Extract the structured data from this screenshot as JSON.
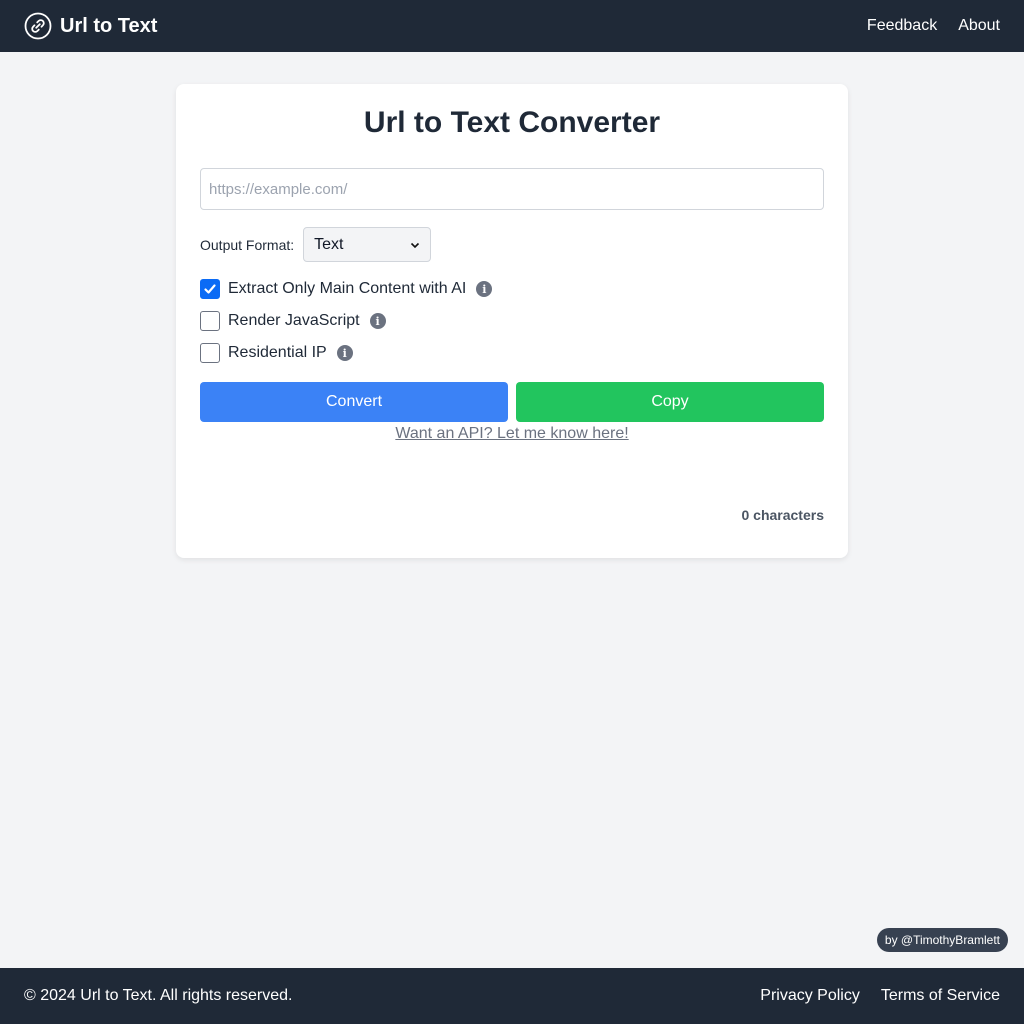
{
  "header": {
    "app_name": "Url to Text",
    "logo_icon": "link-icon",
    "nav": [
      {
        "label": "Feedback"
      },
      {
        "label": "About"
      }
    ]
  },
  "converter": {
    "title": "Url to Text Converter",
    "url_input": {
      "value": "",
      "placeholder": "https://example.com/"
    },
    "output_format": {
      "label": "Output Format:",
      "selected": "Text"
    },
    "options": [
      {
        "label": "Extract Only Main Content with AI",
        "checked": true,
        "info_icon": "info-icon"
      },
      {
        "label": "Render JavaScript",
        "checked": false,
        "info_icon": "info-icon"
      },
      {
        "label": "Residential IP",
        "checked": false,
        "info_icon": "info-icon"
      }
    ],
    "convert_label": "Convert",
    "copy_label": "Copy",
    "api_link": "Want an API? Let me know here!",
    "char_count": "0 characters"
  },
  "credit": "by @TimothyBramlett",
  "footer": {
    "copyright": "© 2024 Url to Text. All rights reserved.",
    "links": [
      {
        "label": "Privacy Policy"
      },
      {
        "label": "Terms of Service"
      }
    ]
  },
  "colors": {
    "header_bg": "#1f2937",
    "convert": "#3b82f6",
    "copy": "#22c55e",
    "checkbox_checked": "#0b6bf5"
  }
}
